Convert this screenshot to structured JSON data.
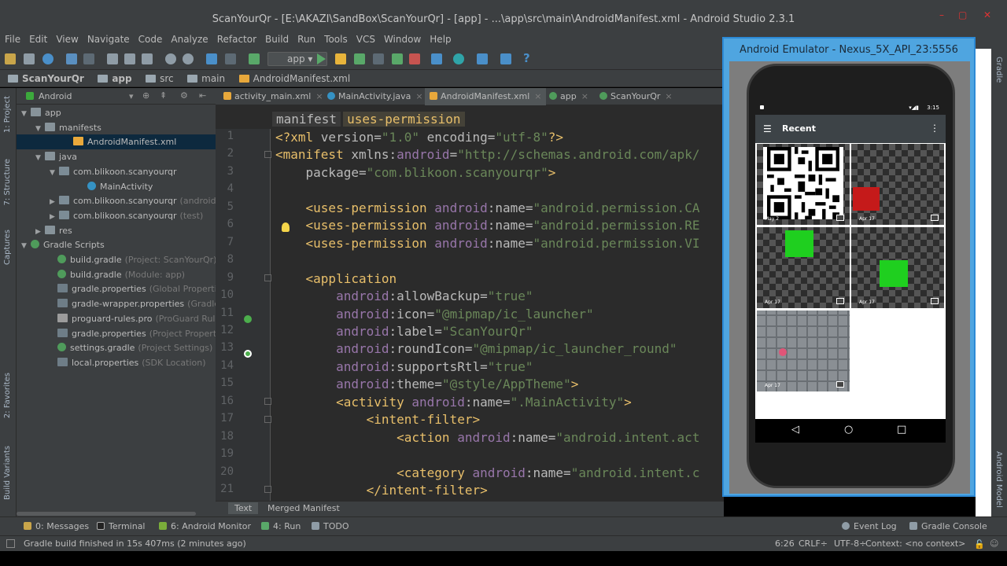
{
  "window": {
    "title": "ScanYourQr - [E:\\AKAZI\\SandBox\\ScanYourQr] - [app] - ...\\app\\src\\main\\AndroidManifest.xml - Android Studio 2.3.1",
    "minimize": "–",
    "maximize": "▢",
    "close": "✕"
  },
  "menu": [
    "File",
    "Edit",
    "View",
    "Navigate",
    "Code",
    "Analyze",
    "Refactor",
    "Build",
    "Run",
    "Tools",
    "VCS",
    "Window",
    "Help"
  ],
  "toolbar": {
    "run_config": "app",
    "help": "?"
  },
  "breadcrumbs": [
    "ScanYourQr",
    "app",
    "src",
    "main",
    "AndroidManifest.xml"
  ],
  "left_tool_tabs": [
    "1: Project",
    "7: Structure",
    "Captures",
    "2: Favorites",
    "Build Variants"
  ],
  "project": {
    "view_label": "Android",
    "tree": [
      {
        "arrow": "▼",
        "icon": "folder",
        "label": "app",
        "hint": ""
      },
      {
        "arrow": "▼",
        "icon": "folder",
        "label": "manifests",
        "hint": ""
      },
      {
        "arrow": "",
        "icon": "xml",
        "label": "AndroidManifest.xml",
        "hint": ""
      },
      {
        "arrow": "▼",
        "icon": "folder",
        "label": "java",
        "hint": ""
      },
      {
        "arrow": "▼",
        "icon": "pkg",
        "label": "com.blikoon.scanyourqr",
        "hint": ""
      },
      {
        "arrow": "",
        "icon": "class",
        "label": "MainActivity",
        "hint": ""
      },
      {
        "arrow": "▶",
        "icon": "pkg",
        "label": "com.blikoon.scanyourqr",
        "hint": "(androidTe"
      },
      {
        "arrow": "▶",
        "icon": "pkg",
        "label": "com.blikoon.scanyourqr",
        "hint": "(test)"
      },
      {
        "arrow": "▶",
        "icon": "folder",
        "label": "res",
        "hint": ""
      },
      {
        "arrow": "▼",
        "icon": "gradle",
        "label": "Gradle Scripts",
        "hint": ""
      },
      {
        "arrow": "",
        "icon": "gradle",
        "label": "build.gradle",
        "hint": "(Project: ScanYourQr)"
      },
      {
        "arrow": "",
        "icon": "gradle",
        "label": "build.gradle",
        "hint": "(Module: app)"
      },
      {
        "arrow": "",
        "icon": "props",
        "label": "gradle.properties",
        "hint": "(Global Properties)"
      },
      {
        "arrow": "",
        "icon": "props",
        "label": "gradle-wrapper.properties",
        "hint": "(Gradle Versi"
      },
      {
        "arrow": "",
        "icon": "pro",
        "label": "proguard-rules.pro",
        "hint": "(ProGuard Rules for"
      },
      {
        "arrow": "",
        "icon": "props",
        "label": "gradle.properties",
        "hint": "(Project Properties)"
      },
      {
        "arrow": "",
        "icon": "gradle",
        "label": "settings.gradle",
        "hint": "(Project Settings)"
      },
      {
        "arrow": "",
        "icon": "props",
        "label": "local.properties",
        "hint": "(SDK Location)"
      }
    ]
  },
  "editor": {
    "tabs": [
      "activity_main.xml",
      "MainActivity.java",
      "AndroidManifest.xml",
      "app",
      "ScanYourQr"
    ],
    "path_crumbs": [
      "manifest",
      "uses-permission"
    ],
    "line_numbers": [
      "1",
      "2",
      "3",
      "4",
      "5",
      "6",
      "7",
      "8",
      "9",
      "10",
      "11",
      "12",
      "13",
      "14",
      "15",
      "16",
      "17",
      "18",
      "19",
      "20",
      "21"
    ],
    "lines": [
      [
        [
          "tg",
          "<?xml "
        ],
        [
          "at",
          "version="
        ],
        [
          "st",
          "\"1.0\" "
        ],
        [
          "at",
          "encoding="
        ],
        [
          "st",
          "\"utf-8\""
        ],
        [
          "tg",
          "?>"
        ]
      ],
      [
        [
          "tg",
          "<manifest "
        ],
        [
          "at",
          "xmlns:"
        ],
        [
          "ns",
          "android"
        ],
        [
          "at",
          "="
        ],
        [
          "st",
          "\"http://schemas.android.com/apk/"
        ]
      ],
      [
        [
          "at",
          "    package="
        ],
        [
          "st",
          "\"com.blikoon.scanyourqr\""
        ],
        [
          "tg",
          ">"
        ]
      ],
      [],
      [
        [
          "tg",
          "    <uses-permission "
        ],
        [
          "ns",
          "android"
        ],
        [
          "at",
          ":name="
        ],
        [
          "st",
          "\"android.permission.CA"
        ]
      ],
      [
        [
          "tg",
          "    <uses-permission "
        ],
        [
          "ns",
          "android"
        ],
        [
          "at",
          ":name="
        ],
        [
          "st",
          "\"android.permission.RE"
        ]
      ],
      [
        [
          "tg",
          "    <uses-permission "
        ],
        [
          "ns",
          "android"
        ],
        [
          "at",
          ":name="
        ],
        [
          "st",
          "\"android.permission.VI"
        ]
      ],
      [],
      [
        [
          "tg",
          "    <application"
        ]
      ],
      [
        [
          "ns",
          "        android"
        ],
        [
          "at",
          ":allowBackup="
        ],
        [
          "st",
          "\"true\""
        ]
      ],
      [
        [
          "ns",
          "        android"
        ],
        [
          "at",
          ":icon="
        ],
        [
          "st",
          "\"@mipmap/ic_launcher\""
        ]
      ],
      [
        [
          "ns",
          "        android"
        ],
        [
          "at",
          ":label="
        ],
        [
          "st",
          "\"ScanYourQr\""
        ]
      ],
      [
        [
          "ns",
          "        android"
        ],
        [
          "at",
          ":roundIcon="
        ],
        [
          "st",
          "\"@mipmap/ic_launcher_round\""
        ]
      ],
      [
        [
          "ns",
          "        android"
        ],
        [
          "at",
          ":supportsRtl="
        ],
        [
          "st",
          "\"true\""
        ]
      ],
      [
        [
          "ns",
          "        android"
        ],
        [
          "at",
          ":theme="
        ],
        [
          "st",
          "\"@style/AppTheme\""
        ],
        [
          "tg",
          ">"
        ]
      ],
      [
        [
          "tg",
          "        <activity "
        ],
        [
          "ns",
          "android"
        ],
        [
          "at",
          ":name="
        ],
        [
          "st",
          "\".MainActivity\""
        ],
        [
          "tg",
          ">"
        ]
      ],
      [
        [
          "tg",
          "            <intent-filter>"
        ]
      ],
      [
        [
          "tg",
          "                <action "
        ],
        [
          "ns",
          "android"
        ],
        [
          "at",
          ":name="
        ],
        [
          "st",
          "\"android.intent.act"
        ]
      ],
      [],
      [
        [
          "tg",
          "                <category "
        ],
        [
          "ns",
          "android"
        ],
        [
          "at",
          ":name="
        ],
        [
          "st",
          "\"android.intent.c"
        ]
      ],
      [
        [
          "tg",
          "            </intent-filter>"
        ]
      ]
    ],
    "bottom_tabs": [
      "Text",
      "Merged Manifest"
    ]
  },
  "emulator": {
    "title": "Android Emulator - Nexus_5X_API_23:5556",
    "status_time": "3:15",
    "app_title": "Recent",
    "menu_glyph": "☰",
    "more_glyph": "⋮",
    "thumbnails": [
      {
        "date": "May 2",
        "kind": "qr"
      },
      {
        "date": "Apr 17",
        "kind": "red"
      },
      {
        "date": "Apr 17",
        "kind": "green1"
      },
      {
        "date": "Apr 17",
        "kind": "green2"
      },
      {
        "date": "Apr 17",
        "kind": "keyboard"
      }
    ],
    "nav": [
      "◁",
      "○",
      "□"
    ]
  },
  "right_tool_tabs": [
    "Gradle",
    "Android Model"
  ],
  "bottom_tools": [
    "0: Messages",
    "Terminal",
    "6: Android Monitor",
    "4: Run",
    "TODO",
    "Event Log",
    "Gradle Console"
  ],
  "status": {
    "message": "Gradle build finished in 15s 407ms (2 minutes ago)",
    "position": "6:26",
    "line_sep": "CRLF÷",
    "encoding": "UTF-8÷",
    "context": "Context: <no context>"
  },
  "colors": {
    "ide_bg": "#3c3f41",
    "editor_bg": "#2b2b2b",
    "tag": "#e8bf6a",
    "string": "#6a8759",
    "namespace": "#9876aa",
    "emulator_frame": "#4fa5e0"
  }
}
